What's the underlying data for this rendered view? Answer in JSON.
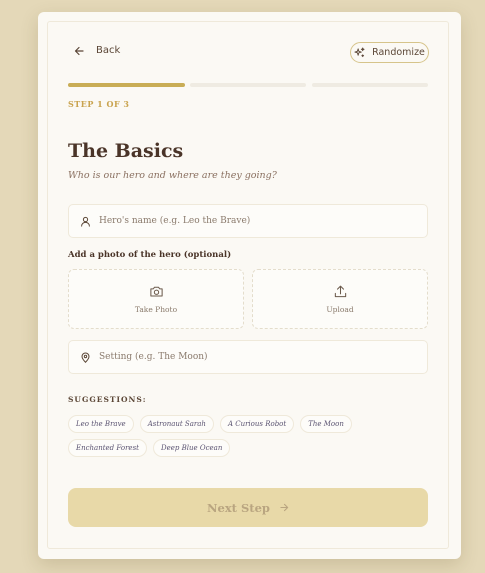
{
  "header": {
    "back_label": "Back",
    "randomize_label": "Randomize"
  },
  "progress": {
    "steps_total": 3,
    "current_step": 1,
    "step_label": "STEP 1 OF 3"
  },
  "main": {
    "title": "The Basics",
    "subtitle": "Who is our hero and where are they going?",
    "name_placeholder": "Hero's name (e.g. Leo the Brave)",
    "name_value": "",
    "photo_label": "Add a photo of the hero (optional)",
    "take_photo_label": "Take Photo",
    "upload_label": "Upload",
    "setting_placeholder": "Setting (e.g. The Moon)",
    "setting_value": ""
  },
  "suggestions": {
    "label": "SUGGESTIONS:",
    "items": [
      "Leo the Brave",
      "Astronaut Sarah",
      "A Curious Robot",
      "The Moon",
      "Enchanted Forest",
      "Deep Blue Ocean"
    ]
  },
  "footer": {
    "next_label": "Next Step"
  },
  "colors": {
    "accent": "#c9ad56",
    "background": "#e4d8b8",
    "card": "#fbf9f4",
    "next_disabled": "#e8d9a8",
    "heading": "#4a3428"
  },
  "icons": {
    "back": "arrow-left-icon",
    "randomize": "sparkles-icon",
    "name": "user-icon",
    "take_photo": "camera-icon",
    "upload": "upload-icon",
    "setting": "map-pin-icon",
    "next": "arrow-right-icon"
  }
}
